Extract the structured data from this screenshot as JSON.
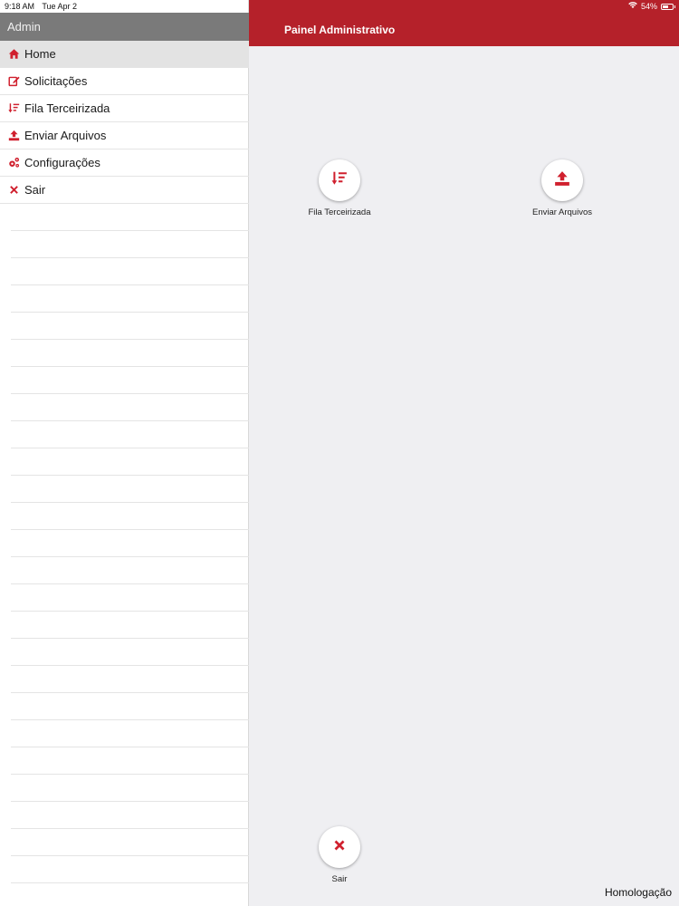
{
  "status_bar": {
    "time": "9:18 AM",
    "date": "Tue Apr 2",
    "battery": "54%"
  },
  "sidebar": {
    "header": "Admin",
    "items": [
      {
        "label": "Home",
        "icon": "home-icon",
        "active": true
      },
      {
        "label": "Solicitações",
        "icon": "edit-icon",
        "active": false
      },
      {
        "label": "Fila Terceirizada",
        "icon": "sort-icon",
        "active": false
      },
      {
        "label": "Enviar Arquivos",
        "icon": "upload-icon",
        "active": false
      },
      {
        "label": "Configurações",
        "icon": "gears-icon",
        "active": false
      },
      {
        "label": "Sair",
        "icon": "close-icon",
        "active": false
      }
    ]
  },
  "main": {
    "title": "Painel Administrativo",
    "tiles": [
      {
        "label": "Fila Terceirizada",
        "icon": "sort-icon"
      },
      {
        "label": "Enviar Arquivos",
        "icon": "upload-icon"
      },
      {
        "label": "Sair",
        "icon": "close-icon"
      }
    ],
    "environment": "Homologação"
  },
  "colors": {
    "accent": "#b5212a",
    "sidebar_header": "#7a7a7a",
    "background": "#efeff2"
  }
}
